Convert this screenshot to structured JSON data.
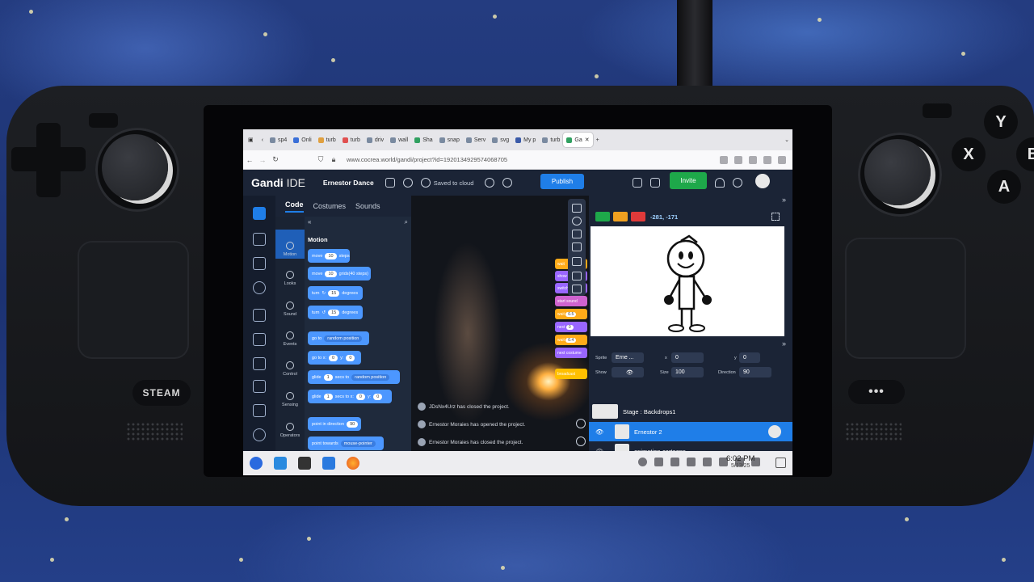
{
  "browser": {
    "tabs": [
      "sp4",
      "Onli",
      "turb",
      "turb",
      "driv",
      "wall",
      "Sha",
      "snap",
      "Serv",
      "svg",
      "My p",
      "turb",
      "Ga"
    ],
    "url": "www.cocrea.world/gandi/project?id=192013492957406870​5"
  },
  "ide": {
    "logo_main": "Gandi",
    "logo_sub": "IDE",
    "project_name": "Ernestor Dance",
    "saved_status": "Saved to cloud",
    "publish_label": "Publish",
    "invite_label": "Invite",
    "editor_tabs": [
      "Code",
      "Costumes",
      "Sounds"
    ],
    "categories": [
      "Motion",
      "Looks",
      "Sound",
      "Events",
      "Control",
      "Sensing",
      "Operators"
    ],
    "palette_title": "Motion",
    "blocks": [
      {
        "parts": [
          "move",
          "10",
          "steps"
        ]
      },
      {
        "parts": [
          "move",
          "10",
          "grids(40 steps)"
        ]
      },
      {
        "parts": [
          "turn",
          "↻",
          "15",
          "degrees"
        ]
      },
      {
        "parts": [
          "turn",
          "↺",
          "15",
          "degrees"
        ]
      },
      {
        "parts": [
          "go to",
          "random position"
        ]
      },
      {
        "parts": [
          "go to x:",
          "0",
          "y:",
          "0"
        ]
      },
      {
        "parts": [
          "glide",
          "1",
          "secs to",
          "random position"
        ]
      },
      {
        "parts": [
          "glide",
          "1",
          "secs to x:",
          "0",
          "y:",
          "0"
        ]
      },
      {
        "parts": [
          "point in direction",
          "90"
        ]
      },
      {
        "parts": [
          "point towards",
          "mouse-pointer"
        ]
      }
    ],
    "workspace_blocks": [
      "wait",
      "show",
      "switch costume",
      "start sound",
      "next",
      "wait",
      "next costume",
      "broadcast"
    ],
    "workspace_values": [
      "0.5",
      "0",
      "0.4"
    ],
    "chat": [
      "JDsNx4Urz has closed the project.",
      "Ernestor Moraies has opened the project.",
      "Ernestor Moraies has closed the project."
    ],
    "stage": {
      "coords_x": "-281",
      "coords_y": "-171"
    },
    "sprite_info": {
      "sprite_label": "Sprite",
      "sprite_name": "Erne ...",
      "x_label": "x",
      "x_value": "0",
      "y_label": "y",
      "y_value": "0",
      "show_label": "Show",
      "size_label": "Size",
      "size_value": "100",
      "direction_label": "Direction",
      "direction_value": "90"
    },
    "stage_row": "Stage : Backdrops1",
    "sprites": [
      "Ernestor 2",
      "animation-cartoons"
    ]
  },
  "taskbar": {
    "time": "6:02 PM",
    "date": "5/13/25"
  },
  "device": {
    "steam_label": "STEAM",
    "buttons": {
      "y": "Y",
      "x": "X",
      "b": "B",
      "a": "A"
    },
    "menu_label": "•••"
  }
}
